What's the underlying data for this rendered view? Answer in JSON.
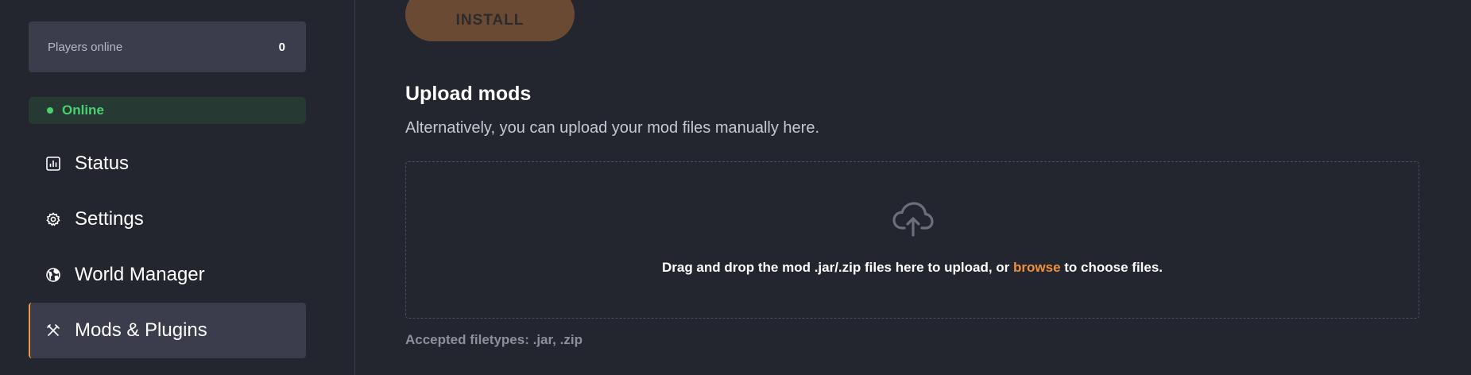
{
  "sidebar": {
    "players": {
      "label": "Players online",
      "count": "0"
    },
    "status": {
      "label": "Online",
      "color": "#4ad06f"
    },
    "items": [
      {
        "label": "Status",
        "icon": "bar-chart-icon",
        "active": false
      },
      {
        "label": "Settings",
        "icon": "gear-icon",
        "active": false
      },
      {
        "label": "World Manager",
        "icon": "globe-icon",
        "active": false
      },
      {
        "label": "Mods & Plugins",
        "icon": "tools-icon",
        "active": true
      }
    ]
  },
  "main": {
    "install_label": "INSTALL",
    "upload": {
      "title": "Upload mods",
      "description": "Alternatively, you can upload your mod files manually here.",
      "drop_text_before": "Drag and drop the mod .jar/.zip files here to upload, or ",
      "browse_label": "browse",
      "drop_text_after": " to choose files.",
      "icon": "cloud-upload-icon",
      "filetypes": "Accepted filetypes: .jar, .zip"
    }
  },
  "colors": {
    "accent": "#e89a45",
    "link": "#f0913c",
    "background": "#23252f",
    "card": "#3b3d4d"
  }
}
